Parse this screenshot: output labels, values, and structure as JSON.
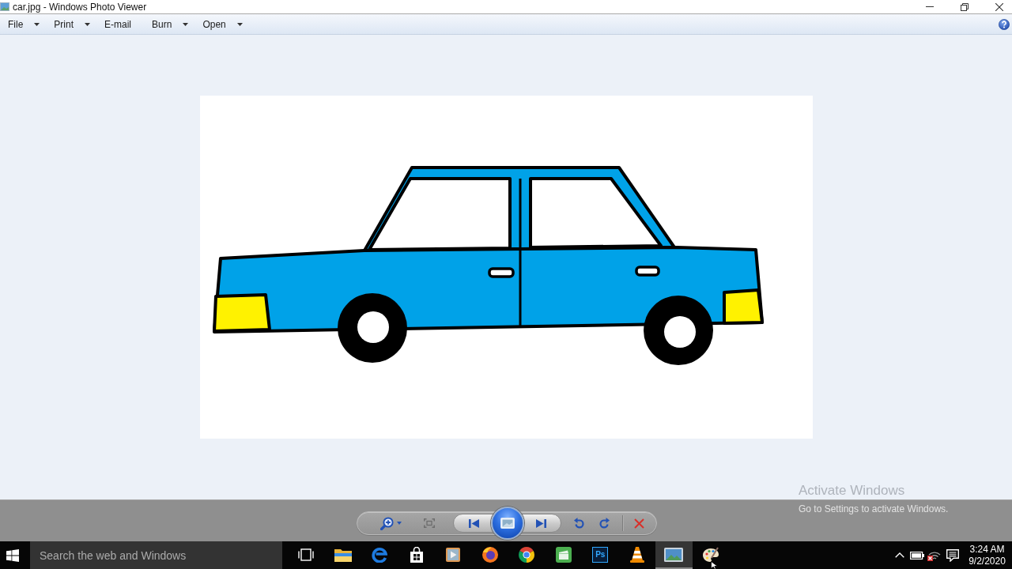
{
  "window": {
    "title": "car.jpg - Windows Photo Viewer"
  },
  "menu": [
    {
      "label": "File",
      "dropdown": true
    },
    {
      "label": "Print",
      "dropdown": true
    },
    {
      "label": "E-mail",
      "dropdown": false
    },
    {
      "label": "Burn",
      "dropdown": true
    },
    {
      "label": "Open",
      "dropdown": true
    }
  ],
  "activation_notice": {
    "title": "Activate Windows",
    "message": "Go to Settings to activate Windows."
  },
  "taskbar": {
    "search": {
      "placeholder": "Search the web and Windows"
    },
    "apps": [
      {
        "selected": false
      },
      {
        "selected": false
      },
      {
        "selected": false
      },
      {
        "selected": false
      },
      {
        "selected": false
      },
      {
        "selected": false
      },
      {
        "selected": false
      },
      {
        "selected": false,
        "logo_text": "Ps"
      },
      {
        "selected": false
      },
      {
        "selected": true
      },
      {
        "selected": false
      }
    ],
    "clock": {
      "time": "3:24 AM",
      "date": "9/2/2020"
    }
  }
}
